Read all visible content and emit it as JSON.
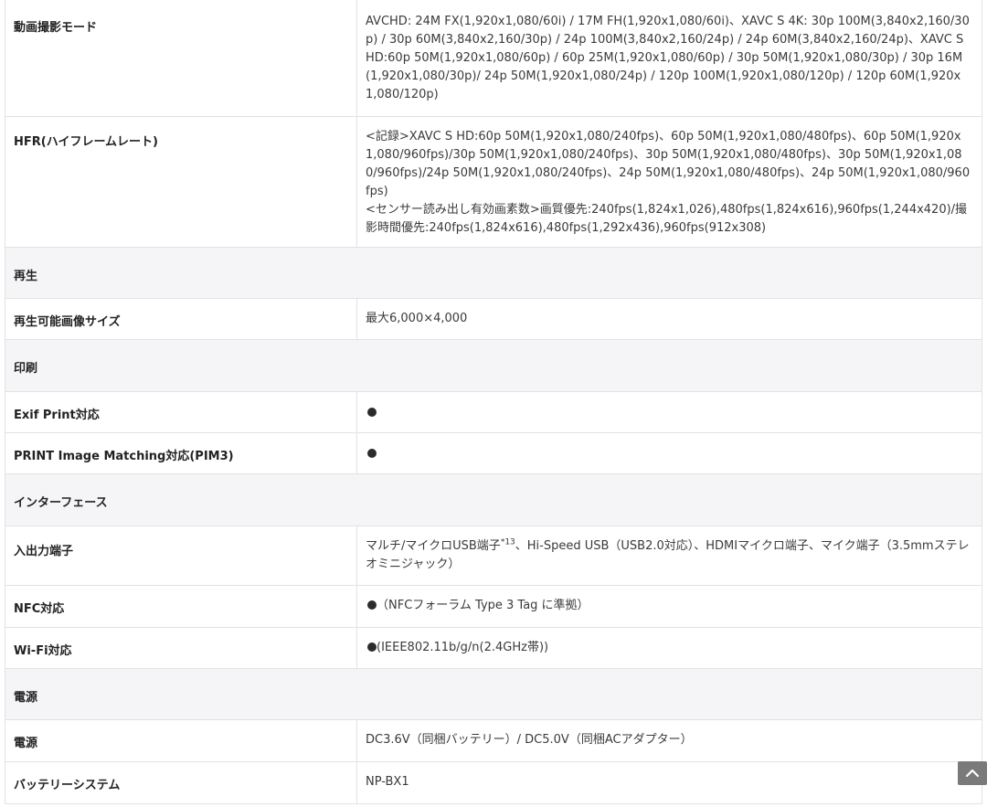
{
  "rows": {
    "movie_mode": {
      "label": "動画撮影モード",
      "value": "AVCHD: 24M FX(1,920x1,080/60i) / 17M FH(1,920x1,080/60i)、XAVC S 4K: 30p 100M(3,840x2,160/30p) / 30p 60M(3,840x2,160/30p) / 24p 100M(3,840x2,160/24p) / 24p 60M(3,840x2,160/24p)、XAVC S HD:60p 50M(1,920x1,080/60p) / 60p 25M(1,920x1,080/60p) / 30p 50M(1,920x1,080/30p) / 30p 16M(1,920x1,080/30p)/ 24p 50M(1,920x1,080/24p) / 120p 100M(1,920x1,080/120p) / 120p 60M(1,920x1,080/120p)"
    },
    "hfr": {
      "label": "HFR(ハイフレームレート)",
      "value_line1": "<記録>XAVC S HD:60p 50M(1,920x1,080/240fps)、60p 50M(1,920x1,080/480fps)、60p 50M(1,920x1,080/960fps)/30p 50M(1,920x1,080/240fps)、30p 50M(1,920x1,080/480fps)、30p 50M(1,920x1,080/960fps)/24p 50M(1,920x1,080/240fps)、24p 50M(1,920x1,080/480fps)、24p 50M(1,920x1,080/960fps)",
      "value_line2": "<センサー読み出し有効画素数>画質優先:240fps(1,824x1,026),480fps(1,824x616),960fps(1,244x420)/撮影時間優先:240fps(1,824x616),480fps(1,292x436),960fps(912x308)"
    },
    "playback_section": {
      "label": "再生"
    },
    "playback_size": {
      "label": "再生可能画像サイズ",
      "value": "最大6,000×4,000"
    },
    "print_section": {
      "label": "印刷"
    },
    "exif_print": {
      "label": "Exif Print対応"
    },
    "pim3": {
      "label": "PRINT Image Matching対応(PIM3)"
    },
    "interface_section": {
      "label": "インターフェース"
    },
    "io_terminal": {
      "label": "入出力端子",
      "value_pre": "マルチ/マイクロUSB端子",
      "value_sup": "*13",
      "value_post": "、Hi-Speed USB（USB2.0対応）、HDMIマイクロ端子、マイク端子（3.5mmステレオミニジャック）"
    },
    "nfc": {
      "label": "NFC対応",
      "value": "（NFCフォーラム Type 3 Tag に準拠）"
    },
    "wifi": {
      "label": "Wi-Fi対応",
      "value": "(IEEE802.11b/g/n(2.4GHz帯))"
    },
    "power_section": {
      "label": "電源"
    },
    "power": {
      "label": "電源",
      "value": "DC3.6V（同梱バッテリー）/ DC5.0V（同梱ACアダプター）"
    },
    "battery": {
      "label": "バッテリーシステム",
      "value": "NP-BX1"
    }
  },
  "icons": {
    "supported_mark": "filled-circle-icon",
    "scroll_top": "chevron-up-icon"
  },
  "colors": {
    "section_bg": "#f5f5f8",
    "border": "#e2e2e2",
    "scroll_button": "#7a7a7a"
  }
}
